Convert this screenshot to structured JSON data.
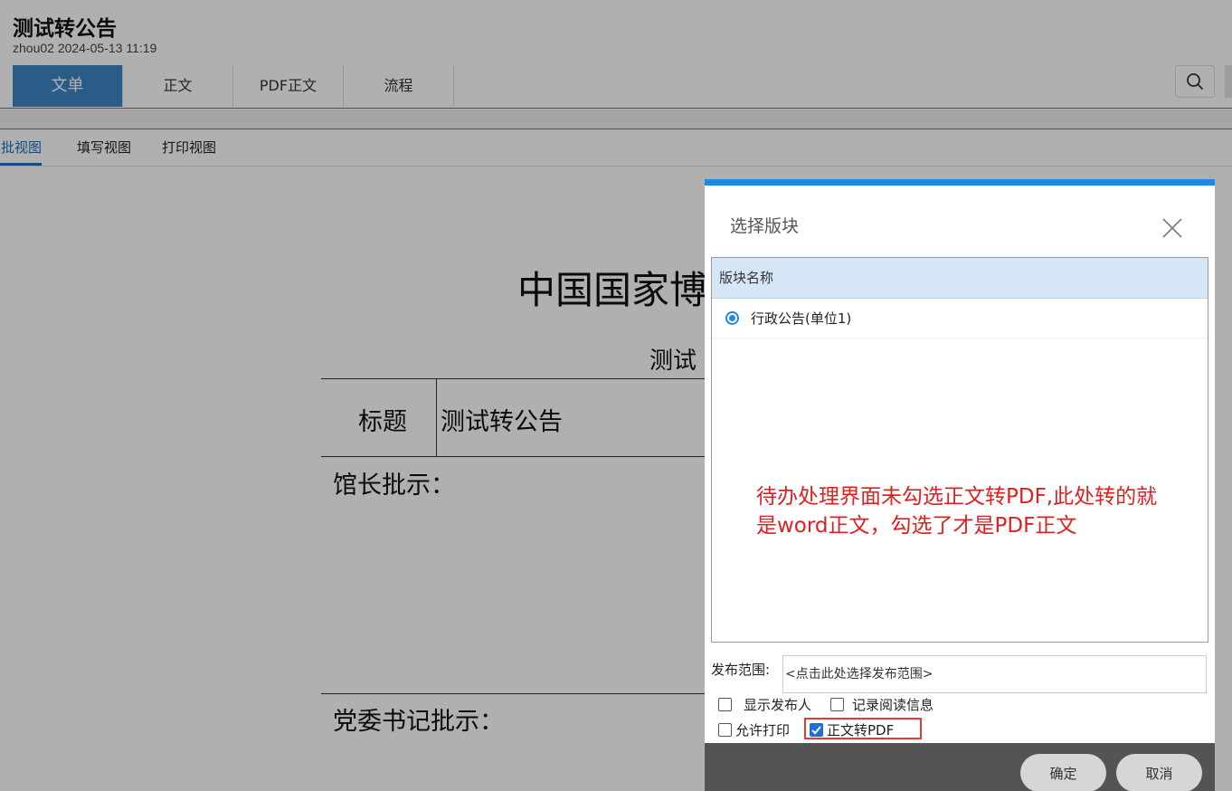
{
  "header": {
    "title": "测试转公告",
    "meta": "zhou02 2024-05-13 11:19",
    "tabs": [
      {
        "label": "文单",
        "active": true
      },
      {
        "label": "正文",
        "active": false
      },
      {
        "label": "PDF正文",
        "active": false
      },
      {
        "label": "流程",
        "active": false
      }
    ],
    "search_icon": "search-icon"
  },
  "view_tabs": [
    {
      "label": "审批视图",
      "active": true
    },
    {
      "label": "填写视图",
      "active": false
    },
    {
      "label": "打印视图",
      "active": false
    }
  ],
  "document": {
    "org_title": "中国国家博",
    "sub_title": "测试",
    "rows": {
      "title_label": "标题",
      "title_value": "测试转公告",
      "director_label": "馆长批示：",
      "party_label": "党委书记批示："
    }
  },
  "modal": {
    "title": "选择版块",
    "list_header": "版块名称",
    "items": [
      {
        "label": "行政公告(单位1)",
        "selected": true
      }
    ],
    "annotation_line1": "待办处理界面未勾选正文转PDF,此处转的就",
    "annotation_line2": "是word正文，勾选了才是PDF正文",
    "scope_label": "发布范围:",
    "scope_value": "<点击此处选择发布范围>",
    "options": {
      "show_publisher": {
        "label": "显示发布人",
        "checked": false
      },
      "record_reading": {
        "label": "记录阅读信息",
        "checked": false
      },
      "allow_print": {
        "label": "允许打印",
        "checked": false
      },
      "convert_pdf": {
        "label": "正文转PDF",
        "checked": true
      }
    },
    "ok_label": "确定",
    "cancel_label": "取消"
  },
  "colors": {
    "accent": "#3e86c6",
    "modal_accent": "#1e88e5",
    "annotation": "#e02020"
  }
}
